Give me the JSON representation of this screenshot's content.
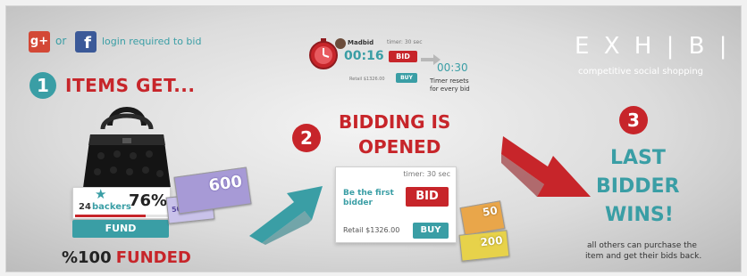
{
  "login": {
    "gplus_icon_text": "g+",
    "or_text": "or",
    "fb_icon_text": "f",
    "message": "login required to bid"
  },
  "brand": {
    "logo": "EXHIBIA",
    "logo_display": "E X H | B | A",
    "tagline": "competitive social shopping"
  },
  "timer_demo": {
    "user_name": "Madbid",
    "timer_label": "timer: 30 sec",
    "countdown": "00:16",
    "bid_label": "BID",
    "retail": "Retail $1326.00",
    "buy_label": "BUY",
    "reset_time": "00:30",
    "reset_note_line1": "Timer resets",
    "reset_note_line2": "for every bid"
  },
  "step1": {
    "number": "1",
    "title": "ITEMS GET...",
    "backers_count": "24",
    "backers_label": "backers",
    "percent": "76%",
    "fund_label": "FUND",
    "funded_prefix": "%100",
    "funded_word": "FUNDED",
    "bill_large_value": "600",
    "bill_small_value": "500"
  },
  "step2": {
    "number": "2",
    "title_line1": "BIDDING IS",
    "title_line2": "OPENED",
    "timer_label": "timer: 30 sec",
    "prompt_line1": "Be the first",
    "prompt_line2": "bidder",
    "bid_label": "BID",
    "retail": "Retail $1326.00",
    "buy_label": "BUY",
    "bill_large_value": "50",
    "bill_small_value": "200"
  },
  "step3": {
    "number": "3",
    "title_line1": "LAST",
    "title_line2": "BIDDER",
    "title_line3": "WINS!",
    "note_line1": "all others can purchase the",
    "note_line2": "item and get their bids back."
  },
  "colors": {
    "red": "#c7252a",
    "teal": "#3a9ea5",
    "facebook": "#3b5998",
    "gplus": "#d34836",
    "bill_purple": "#a79ad6",
    "bill_orange": "#e9a64a",
    "progress": 0.76
  }
}
